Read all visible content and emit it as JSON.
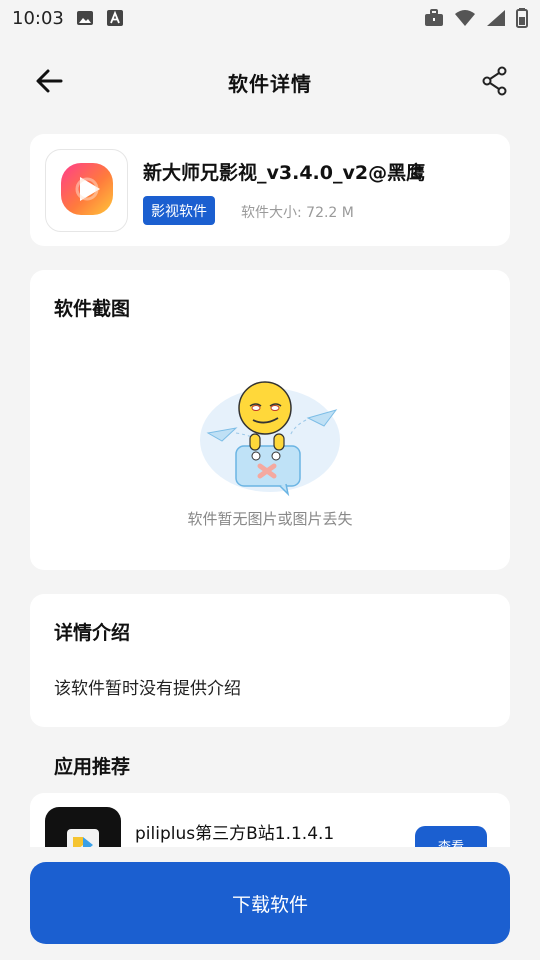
{
  "status_bar": {
    "time": "10:03",
    "left_icons": [
      "image-icon",
      "text-a-icon"
    ],
    "right_icons": [
      "briefcase-icon",
      "wifi-icon",
      "signal-icon",
      "battery-icon"
    ]
  },
  "header": {
    "title": "软件详情",
    "back_icon": "arrow-left-icon",
    "share_icon": "share-icon"
  },
  "app": {
    "name": "新大师兄影视_v3.4.0_v2@黑鹰",
    "category": "影视软件",
    "size_label": "软件大小: 72.2 M",
    "icon": "video-play-icon"
  },
  "screenshots": {
    "title": "软件截图",
    "empty_text": "软件暂无图片或图片丢失"
  },
  "intro": {
    "title": "详情介绍",
    "text": "该软件暂时没有提供介绍"
  },
  "recommend": {
    "title": "应用推荐",
    "items": [
      {
        "name": "piliplus第三方B站1.1.4.1",
        "button": "查看"
      }
    ]
  },
  "download": {
    "label": "下载软件"
  },
  "colors": {
    "primary": "#1b5fd0",
    "background": "#f4f4f4",
    "card": "#ffffff"
  }
}
